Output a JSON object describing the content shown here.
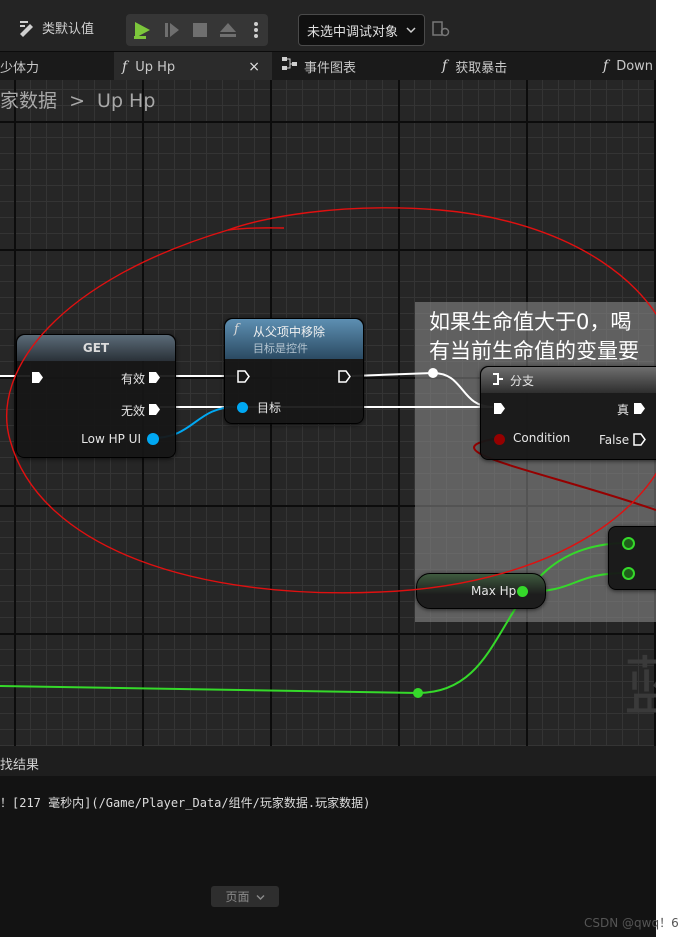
{
  "toolbar": {
    "class_defaults_label": "类默认值",
    "debug_target": "未选中调试对象"
  },
  "tabs": [
    {
      "label": "少体力"
    },
    {
      "label": "Up Hp",
      "close": "×"
    },
    {
      "label": "事件图表"
    },
    {
      "label": "获取暴击"
    },
    {
      "label": "Down"
    }
  ],
  "breadcrumb": {
    "parent": "家数据",
    "separator": ">",
    "current": "Up Hp"
  },
  "comment": {
    "text": "如果生命值大于0，喝\n有当前生命值的变量要"
  },
  "nodes": {
    "get": {
      "title": "GET",
      "valid": "有效",
      "invalid": "无效",
      "var": "Low HP UI"
    },
    "remove": {
      "title": "从父项中移除",
      "subtitle": "目标是控件",
      "target": "目标"
    },
    "branch": {
      "title": "分支",
      "condition": "Condition",
      "true_label": "真",
      "false_label": "False"
    },
    "maxhp": {
      "label": "Max Hp"
    }
  },
  "bottom_glyph": "蓝",
  "results": {
    "header": "找结果",
    "line": "！[217 毫秒内](/Game/Player_Data/组件/玩家数据.玩家数据)",
    "page_button": "页面"
  },
  "watermark": "CSDN @qwq！6",
  "colors": {
    "exec": "#ffffff",
    "object_pin": "#00a8f3",
    "bool_pin": "#950000",
    "float_pin": "#35d92a",
    "annotation": "#e01010"
  }
}
